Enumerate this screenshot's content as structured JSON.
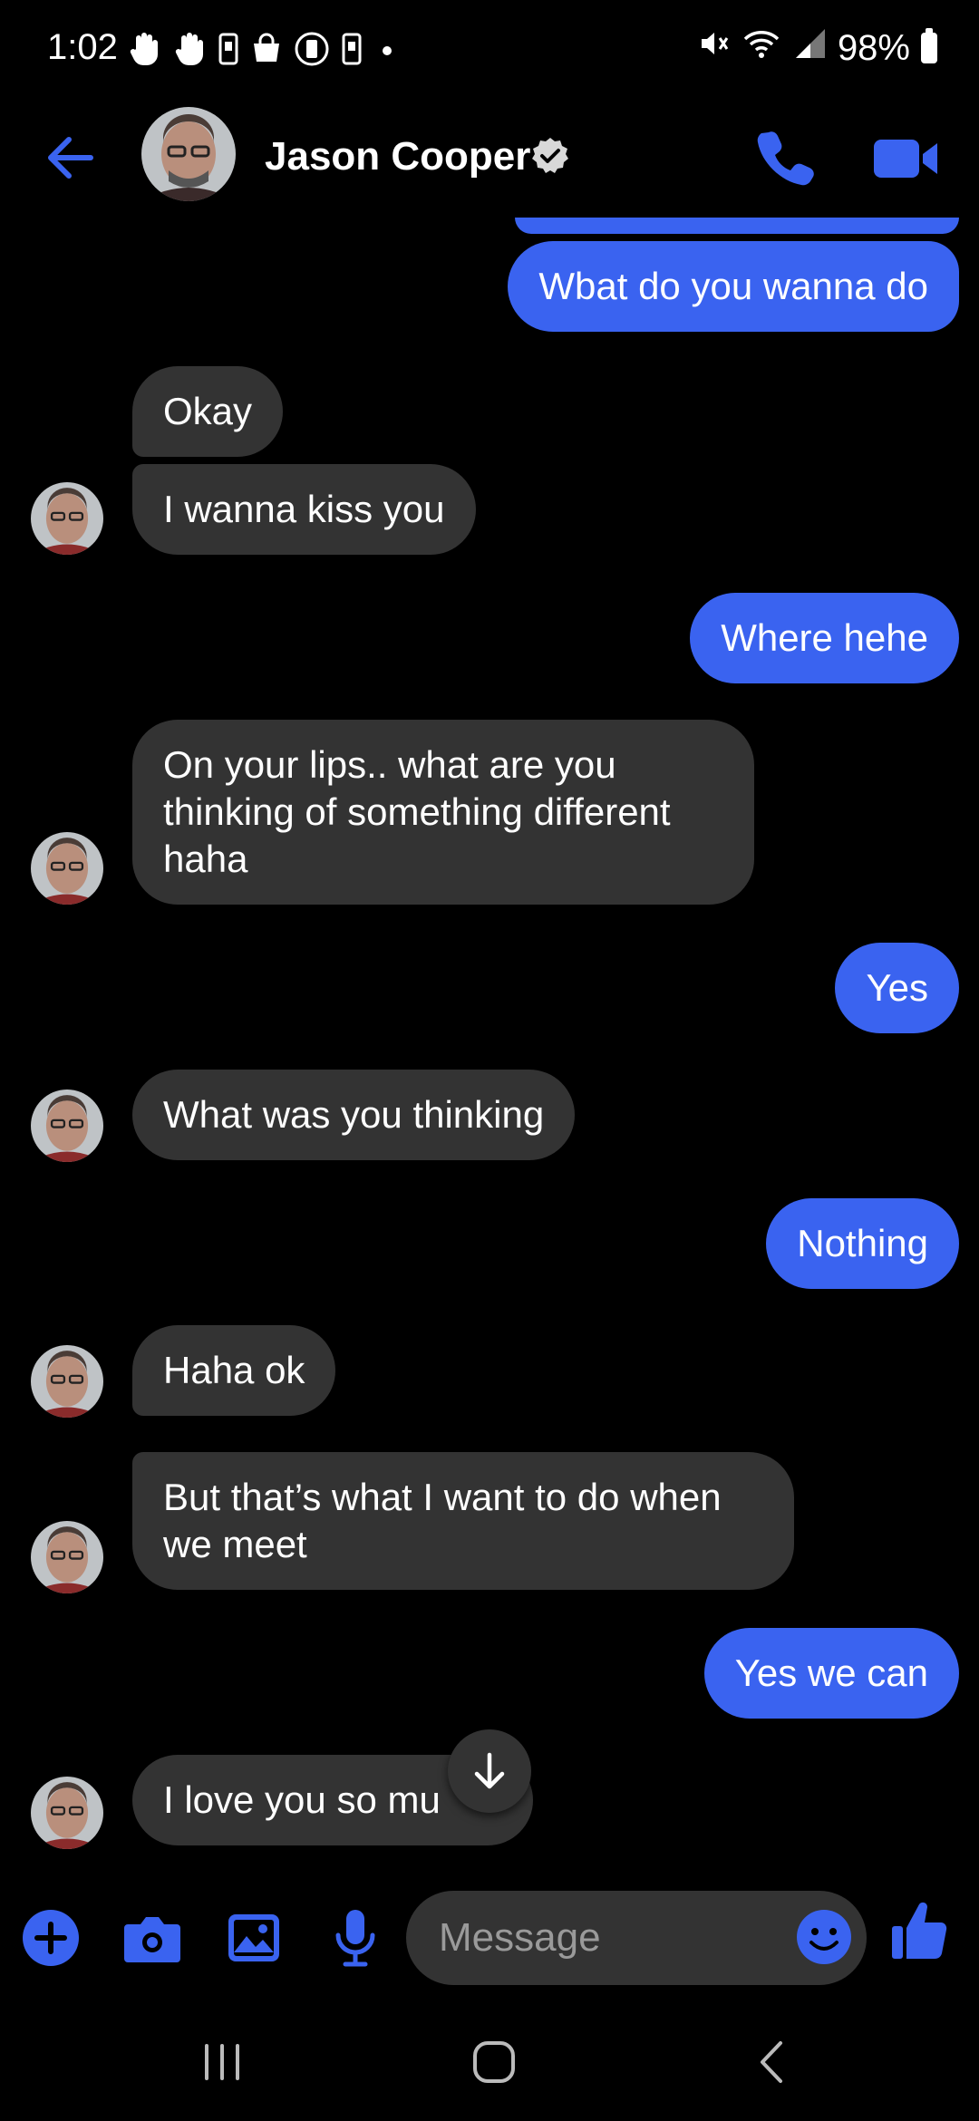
{
  "status": {
    "time": "1:02",
    "battery": "98%",
    "left_icons": [
      "hand-icon",
      "hand-icon",
      "phone-icon",
      "bag-icon",
      "circle-phone-icon",
      "phone-icon",
      "dot-icon"
    ],
    "right_icons": [
      "mute-icon",
      "wifi-icon",
      "signal-icon",
      "battery-icon"
    ]
  },
  "header": {
    "contact_name": "Jason Cooper",
    "verified": true
  },
  "messages": [
    {
      "dir": "out",
      "text": "Wbat do you wanna do"
    },
    {
      "dir": "in",
      "text": "Okay"
    },
    {
      "dir": "in",
      "text": "I wanna kiss you"
    },
    {
      "dir": "out",
      "text": "Where hehe"
    },
    {
      "dir": "in",
      "text": "On your lips.. what are you thinking of something different haha"
    },
    {
      "dir": "out",
      "text": "Yes"
    },
    {
      "dir": "in",
      "text": "What was you thinking"
    },
    {
      "dir": "out",
      "text": "Nothing"
    },
    {
      "dir": "in",
      "text": "Haha ok"
    },
    {
      "dir": "in",
      "text": "But that’s what I want to do when we meet"
    },
    {
      "dir": "out",
      "text": "Yes we can"
    },
    {
      "dir": "in",
      "text": "I love you so mu"
    }
  ],
  "composer": {
    "placeholder": "Message"
  },
  "colors": {
    "accent": "#3a63f0",
    "incoming_bubble": "#333333",
    "background": "#000000"
  }
}
